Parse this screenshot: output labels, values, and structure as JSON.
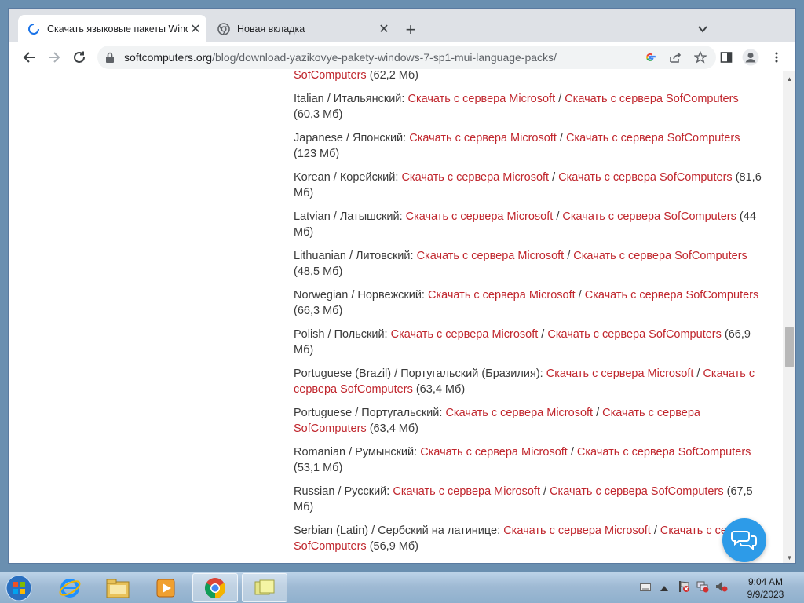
{
  "browser": {
    "tabs": [
      {
        "label": "Скачать языковые пакеты Windows",
        "active": true
      },
      {
        "label": "Новая вкладка",
        "active": false
      }
    ],
    "url_host": "softcomputers.org",
    "url_path": "/blog/download-yazikovye-pakety-windows-7-sp1-mui-language-packs/"
  },
  "page": {
    "link_ms": "Скачать с сервера Microsoft",
    "link_sc": "Скачать с сервера SofComputers",
    "separator": " / ",
    "partial_entry": {
      "link_tail": "SofComputers",
      "size": " (62,2 Мб)"
    },
    "entries": [
      {
        "label": "Italian / Итальянский: ",
        "size": " (60,3 Мб)"
      },
      {
        "label": "Japanese / Японский: ",
        "size": " (123 Мб)"
      },
      {
        "label": "Korean / Корейский: ",
        "size": " (81,6 Мб)"
      },
      {
        "label": "Latvian / Латышский: ",
        "size": " (44 Мб)"
      },
      {
        "label": "Lithuanian / Литовский: ",
        "size": " (48,5 Мб)"
      },
      {
        "label": "Norwegian / Норвежский: ",
        "size": " (66,3 Мб)"
      },
      {
        "label": "Polish / Польский: ",
        "size": " (66,9 Мб)"
      },
      {
        "label": "Portuguese (Brazil) / Португальский (Бразилия): ",
        "size": " (63,4 Мб)"
      },
      {
        "label": "Portuguese / Португальский: ",
        "size": " (63,4 Мб)"
      },
      {
        "label": "Romanian / Румынский: ",
        "size": " (53,1 Мб)"
      },
      {
        "label": "Russian / Русский: ",
        "size": " (67,5 Мб)"
      },
      {
        "label": "Serbian (Latin) / Сербский на латинице: ",
        "size": " (56,9 Мб)"
      }
    ]
  },
  "taskbar": {
    "time": "9:04 AM",
    "date": "9/9/2023"
  },
  "colors": {
    "link": "#c0262d",
    "accent": "#2d9be8"
  }
}
